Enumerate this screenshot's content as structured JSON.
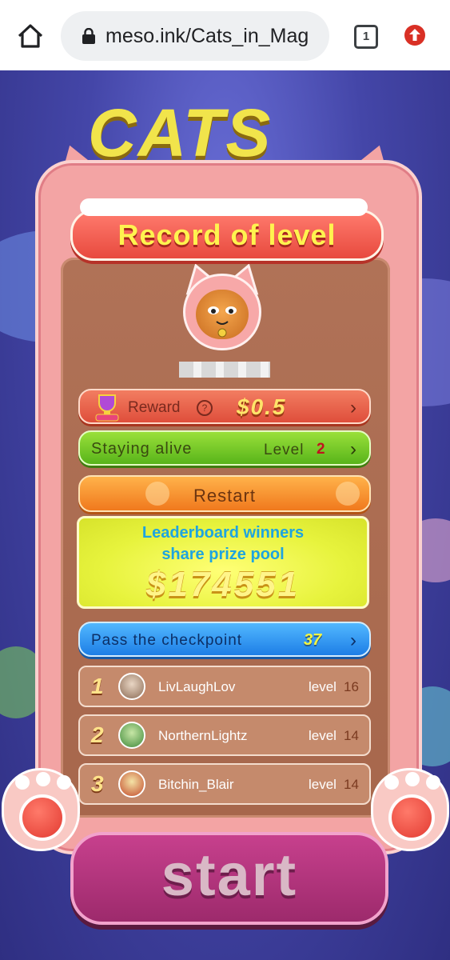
{
  "browser": {
    "url": "meso.ink/Cats_in_Mag",
    "tab_count": "1"
  },
  "game": {
    "title": "Record of level",
    "player_name": "",
    "reward": {
      "label": "Reward",
      "help": "?",
      "amount": "$0.5"
    },
    "staying_alive": {
      "label": "Staying alive",
      "level_label": "Level",
      "level_value": "2"
    },
    "restart_label": "Restart",
    "prize": {
      "line1": "Leaderboard winners",
      "line2": "share prize pool",
      "amount": "$174551"
    },
    "checkpoint": {
      "label": "Pass the checkpoint",
      "value": "37"
    },
    "leaderboard": [
      {
        "rank": "1",
        "name": "LivLaughLov",
        "level_label": "level",
        "level": "16"
      },
      {
        "rank": "2",
        "name": "NorthernLightz",
        "level_label": "level",
        "level": "14"
      },
      {
        "rank": "3",
        "name": "Bitchin_Blair",
        "level_label": "level",
        "level": "14"
      }
    ],
    "start_label": "start"
  },
  "colors": {
    "reward": "#df4e3b",
    "alive": "#58b41a",
    "restart": "#f0791d",
    "checkpoint": "#1d7ee6",
    "prize_text": "#1ea4e0"
  }
}
